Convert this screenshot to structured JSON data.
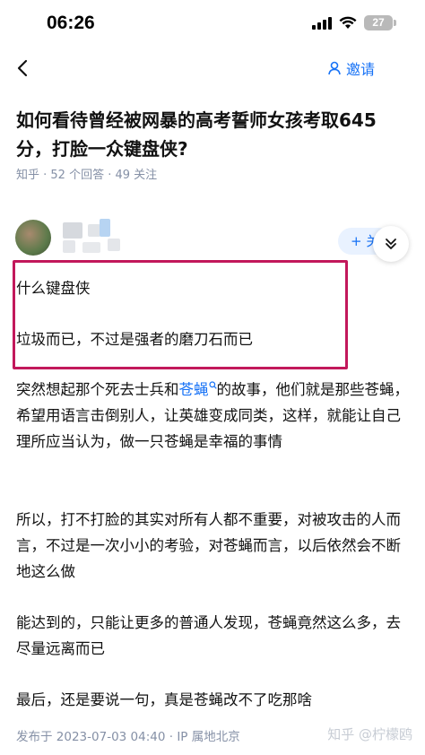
{
  "status_bar": {
    "time": "06:26",
    "battery": "27"
  },
  "nav": {
    "invite_label": "邀请"
  },
  "question": {
    "title": "如何看待曾经被网暴的高考誓师女孩考取645分，打脸一众键盘侠?",
    "meta": "知乎 · 52 个回答 · 49 关注"
  },
  "author": {
    "follow_label": "+ 关注"
  },
  "answer": {
    "p1": "什么键盘侠",
    "p2": "垃圾而已，不过是强者的磨刀石而已",
    "p3_before": "突然想起那个死去士兵和",
    "p3_keyword": "苍蝇",
    "p3_after": "的故事，他们就是那些苍蝇，希望用语言击倒别人，让英雄变成同类，这样，就能让自己理所应当认为，做一只苍蝇是幸福的事情",
    "p4": "所以，打不打脸的其实对所有人都不重要，对被攻击的人而言，不过是一次小小的考验，对苍蝇而言，以后依然会不断地这么做",
    "p5": "能达到的，只能让更多的普通人发现，苍蝇竟然这么多，去尽量远离而已",
    "p6": "最后，还是要说一句，真是苍蝇改不了吃那啥"
  },
  "footer": {
    "publish_info": "发布于 2023-07-03 04:40 · IP 属地北京",
    "watermark": "知乎 @柠檬鸥"
  },
  "colors": {
    "accent": "#1772f6",
    "highlight_border": "#c2185b",
    "meta": "#8590a6"
  }
}
